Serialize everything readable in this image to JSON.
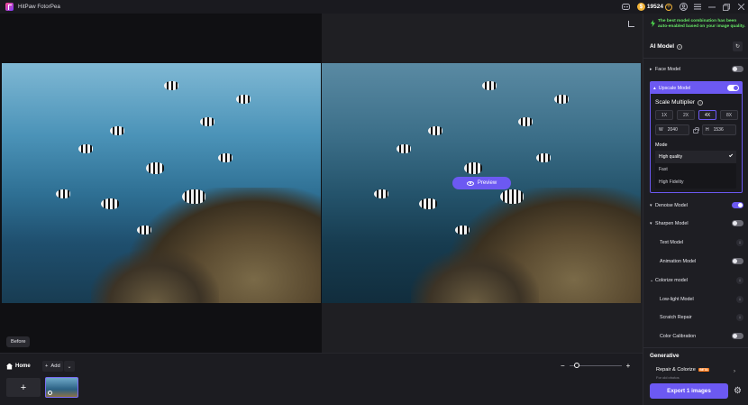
{
  "window": {
    "title": "HitPaw FotorPea",
    "credits": "19524",
    "credit_symbol": "$",
    "controls": [
      "discord-icon",
      "user-icon",
      "menu-icon",
      "minimize-icon",
      "restore-icon",
      "close-icon"
    ]
  },
  "canvas": {
    "before_label": "Before",
    "preview_label": "Preview"
  },
  "bottom": {
    "home_label": "Home",
    "add_label": "Add",
    "zoom_out": "−",
    "zoom_in": "+",
    "zoom_level": 0.15
  },
  "panel": {
    "notice": "The best model combination has been auto-enabled based on your image quality.",
    "ai_model_title": "AI Model",
    "face_model": {
      "label": "Face Model",
      "enabled": false
    },
    "upscale_model": {
      "label": "Upscale Model",
      "enabled": true,
      "scale_title": "Scale Multiplier",
      "scale_options": [
        "1X",
        "2X",
        "4X",
        "8X"
      ],
      "selected_scale": "4X",
      "width_label": "W",
      "width_value": "2040",
      "height_label": "H",
      "height_value": "1536",
      "mode_label": "Mode",
      "modes": [
        "High quality",
        "Fast",
        "High Fidelity"
      ],
      "selected_mode": "High quality"
    },
    "denoise_model": {
      "label": "Denoise Model",
      "enabled": true
    },
    "sharpen_model": {
      "label": "Sharpen Model",
      "enabled": false
    },
    "text_model": {
      "label": "Text Model"
    },
    "animation_model": {
      "label": "Animation Model",
      "enabled": false
    },
    "colorize_model": {
      "label": "Colorize model"
    },
    "lowlight_model": {
      "label": "Low-light Model"
    },
    "scratch_repair": {
      "label": "Scratch Repair"
    },
    "color_calibration": {
      "label": "Color Calibration",
      "enabled": false
    },
    "generative_title": "Generative",
    "repair_colorize": {
      "label": "Repair & Colorize",
      "badge": "BETA",
      "subtitle": "For old photos"
    },
    "export_label": "Export 1 images"
  },
  "colors": {
    "accent": "#6c59f2",
    "notice_green": "#66e866",
    "beta_orange": "#ff7a1a",
    "coin_gold": "#f2b43a"
  }
}
